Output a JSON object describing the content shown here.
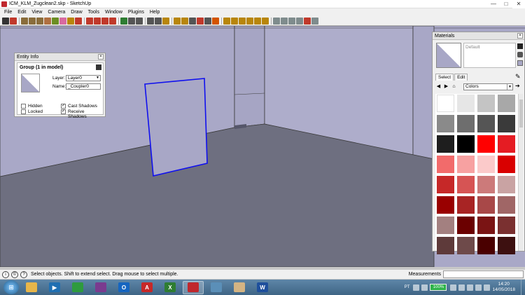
{
  "window": {
    "title": "ICM_KLM_Zugclean2.skp - SketchUp",
    "minimize": "—",
    "maximize": "□",
    "close": "✕"
  },
  "menu": [
    "File",
    "Edit",
    "View",
    "Camera",
    "Draw",
    "Tools",
    "Window",
    "Plugins",
    "Help"
  ],
  "toolbar_icons": [
    {
      "name": "select-tool-icon",
      "color": "#333333"
    },
    {
      "name": "pencil-tool-icon",
      "color": "#c0392b"
    },
    {
      "name": "rectangle-tool-icon",
      "color": "#8a6d3b"
    },
    {
      "name": "circle-tool-icon",
      "color": "#8a6d3b"
    },
    {
      "name": "polygon-tool-icon",
      "color": "#8a6d3b"
    },
    {
      "name": "arc-tool-icon",
      "color": "#b07040"
    },
    {
      "name": "make-component-icon",
      "color": "#6b8e23"
    },
    {
      "name": "eraser-tool-icon",
      "color": "#d96aa0"
    },
    {
      "name": "paint-bucket-icon",
      "color": "#b8860b"
    },
    {
      "name": "push-pull-icon",
      "color": "#c0392b"
    },
    {
      "name": "move-tool-icon",
      "color": "#c0392b"
    },
    {
      "name": "rotate-tool-icon",
      "color": "#c0392b"
    },
    {
      "name": "scale-tool-icon",
      "color": "#c0392b"
    },
    {
      "name": "offset-tool-icon",
      "color": "#c0392b"
    },
    {
      "name": "orbit-tool-icon",
      "color": "#2e7d32"
    },
    {
      "name": "pan-tool-icon",
      "color": "#555555"
    },
    {
      "name": "zoom-tool-icon",
      "color": "#555555"
    },
    {
      "name": "zoom-window-icon",
      "color": "#555555"
    },
    {
      "name": "zoom-extents-icon",
      "color": "#555555"
    },
    {
      "name": "tape-measure-icon",
      "color": "#b8860b"
    },
    {
      "name": "dimension-tool-icon",
      "color": "#b8860b"
    },
    {
      "name": "protractor-icon",
      "color": "#b8860b"
    },
    {
      "name": "text-tool-icon",
      "color": "#555555"
    },
    {
      "name": "axes-tool-icon",
      "color": "#c0392b"
    },
    {
      "name": "3d-text-icon",
      "color": "#555555"
    },
    {
      "name": "section-plane-icon",
      "color": "#d35400"
    },
    {
      "name": "iso-view-icon",
      "color": "#b8860b"
    },
    {
      "name": "top-view-icon",
      "color": "#b8860b"
    },
    {
      "name": "front-view-icon",
      "color": "#b8860b"
    },
    {
      "name": "right-view-icon",
      "color": "#b8860b"
    },
    {
      "name": "back-view-icon",
      "color": "#b8860b"
    },
    {
      "name": "left-view-icon",
      "color": "#b8860b"
    },
    {
      "name": "xray-icon",
      "color": "#7f8c8d"
    },
    {
      "name": "wireframe-icon",
      "color": "#7f8c8d"
    },
    {
      "name": "hidden-line-icon",
      "color": "#7f8c8d"
    },
    {
      "name": "shaded-icon",
      "color": "#7f8c8d"
    },
    {
      "name": "shaded-textures-icon",
      "color": "#c0392b"
    },
    {
      "name": "monochrome-icon",
      "color": "#7f8c8d"
    }
  ],
  "entity_info": {
    "title": "Entity Info",
    "group_label": "Group (1 in model)",
    "layer_label": "Layer:",
    "layer_value": "Layer0",
    "name_label": "Name:",
    "name_value": "_Coupler0",
    "hidden_label": "Hidden",
    "locked_label": "Locked",
    "cast_shadows_label": "Cast Shadows",
    "receive_shadows_label": "Receive Shadows",
    "hidden": false,
    "locked": false,
    "cast_shadows": true,
    "receive_shadows": true
  },
  "materials": {
    "title": "Materials",
    "material_name": "Default",
    "tabs": [
      "Select",
      "Edit"
    ],
    "active_tab": "Select",
    "library": "Colors",
    "swatches": [
      "#ffffff",
      "#e6e6e6",
      "#c4c4c4",
      "#a8a8a8",
      "#8a8a8a",
      "#6e6e6e",
      "#555555",
      "#3a3a3a",
      "#1e1e1e",
      "#000000",
      "#ff0000",
      "#e51c23",
      "#f26b6b",
      "#f7a1a1",
      "#fbcaca",
      "#d90000",
      "#c62828",
      "#d65454",
      "#cc7a7a",
      "#c9a3a3",
      "#990000",
      "#a82424",
      "#a84848",
      "#a06666",
      "#a38080",
      "#6b0000",
      "#7a1414",
      "#7a3030",
      "#5e3a3a",
      "#6e4a4a",
      "#4a0000",
      "#3d1010"
    ]
  },
  "status": {
    "text": "Select objects. Shift to extend select. Drag mouse to select multiple.",
    "measurements_label": "Measurements"
  },
  "taskbar": {
    "apps": [
      {
        "name": "taskbar-explorer",
        "label": "",
        "color": "#e8b64a",
        "active": false
      },
      {
        "name": "taskbar-media",
        "label": "▶",
        "color": "#1f6fb2",
        "active": false
      },
      {
        "name": "taskbar-chrome",
        "label": "",
        "color": "#2e9b3e",
        "active": false
      },
      {
        "name": "taskbar-winrar",
        "label": "",
        "color": "#7a3b8f",
        "active": false
      },
      {
        "name": "taskbar-outlook",
        "label": "O",
        "color": "#1565c0",
        "active": false
      },
      {
        "name": "taskbar-acrobat",
        "label": "A",
        "color": "#c62828",
        "active": false
      },
      {
        "name": "taskbar-excel",
        "label": "X",
        "color": "#2e7d32",
        "active": false
      },
      {
        "name": "taskbar-sketchup",
        "label": "",
        "color": "#c0272d",
        "active": true
      },
      {
        "name": "taskbar-photos",
        "label": "",
        "color": "#5b8fb8",
        "active": false
      },
      {
        "name": "taskbar-notes",
        "label": "",
        "color": "#d4b483",
        "active": false
      },
      {
        "name": "taskbar-word",
        "label": "W",
        "color": "#1e4f9c",
        "active": false
      }
    ],
    "language": "PT",
    "battery": "100%",
    "time": "14:20",
    "date": "14/05/2018"
  },
  "colors": {
    "floor": "#6e6f80",
    "wall_left": "#a9a8c7",
    "wall_back": "#a6a5c4",
    "wall_right": "#aeadcb",
    "selection": "#1010ee",
    "panel_face": "#a8a7c6"
  }
}
